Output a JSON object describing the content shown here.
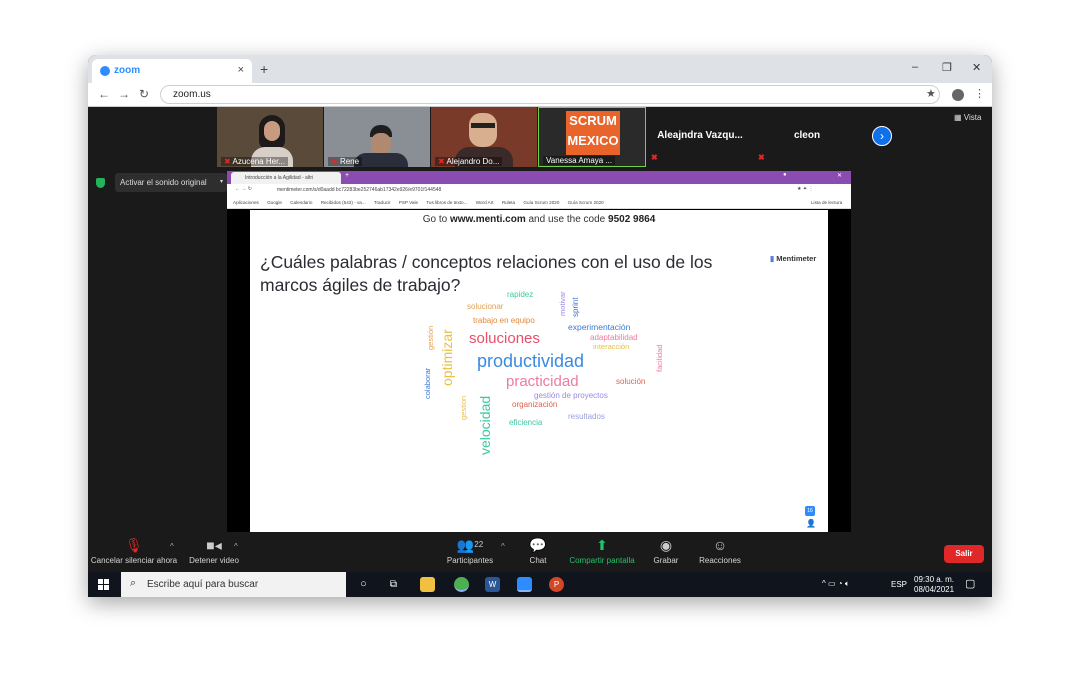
{
  "browser": {
    "tab_title": "zoom",
    "tab_close": "×",
    "new_tab": "+",
    "url": "zoom.us",
    "window_controls": [
      "–",
      "❐",
      "✕"
    ]
  },
  "participants_strip": {
    "videos": [
      {
        "name": "Azucena Her...",
        "bg": "#5a4a3a"
      },
      {
        "name": "Rene",
        "bg": "#8a8f96"
      },
      {
        "name": "Alejandro Do...",
        "bg": "#7a3a2a"
      },
      {
        "name": "Vanessa Amaya ...",
        "bg": "#2a2a2a"
      }
    ],
    "name_only": [
      {
        "name": "Aleajndra Vazqu..."
      },
      {
        "name": "cleon"
      }
    ],
    "scrum_logo_text": [
      "SCRUM",
      "MEXICO"
    ],
    "vista_label": "Vista"
  },
  "audio": {
    "activar_label": "Activar el sonido original"
  },
  "shared_browser": {
    "tab_title": "Introducción a la Agilidad - altri",
    "url": "mentimeter.com/s/d0aadd bc72283be252746ab17342e926/e9701f144548",
    "bookmarks": [
      "Aplicaciones",
      "Google",
      "Calendario",
      "Recibidos (543) - va...",
      "Traducir",
      "PSP Vale",
      "Tus libros de texto...",
      "Word Art",
      "Ruleta",
      "Guía Scrum 2020",
      "Guía Scrum 2020",
      "Lista de lectura"
    ]
  },
  "slide": {
    "goto_prefix": "Go to",
    "goto_site": "www.menti.com",
    "goto_mid": "and use the code",
    "goto_code": "9502 9864",
    "question_line1": "¿Cuáles palabras / conceptos relaciones con el uso de los",
    "question_line2": "marcos ágiles de trabajo?",
    "brand": "Mentimeter",
    "audience_count": "16",
    "words": [
      {
        "text": "rapidez",
        "color": "#3cc8a0"
      },
      {
        "text": "solucionar",
        "color": "#e0a050"
      },
      {
        "text": "trabajo en equipo",
        "color": "#e08a3a"
      },
      {
        "text": "experimentación",
        "color": "#3a7ad0"
      },
      {
        "text": "adaptabilidad",
        "color": "#ef7aa0"
      },
      {
        "text": "interacción",
        "color": "#e8c040"
      },
      {
        "text": "soluciones",
        "color": "#e8506a"
      },
      {
        "text": "productividad",
        "color": "#3a8ae0"
      },
      {
        "text": "practicidad",
        "color": "#ef7aa0"
      },
      {
        "text": "solución",
        "color": "#e06050"
      },
      {
        "text": "gestión de proyectos",
        "color": "#9a8ae0"
      },
      {
        "text": "organización",
        "color": "#e06050"
      },
      {
        "text": "resultados",
        "color": "#9aa0e0"
      },
      {
        "text": "eficiencia",
        "color": "#3cc8a0"
      },
      {
        "text": "optimizar",
        "color": "#e8c040"
      },
      {
        "text": "gestión",
        "color": "#e0a050"
      },
      {
        "text": "colaborar",
        "color": "#3a7ad0"
      },
      {
        "text": "velocidad",
        "color": "#3cc8a0"
      },
      {
        "text": "gestion",
        "color": "#e8c040"
      },
      {
        "text": "motivar",
        "color": "#9a8ae0"
      },
      {
        "text": "sprint",
        "color": "#3a7ad0"
      },
      {
        "text": "facilidad",
        "color": "#ef7aa0"
      }
    ]
  },
  "zoom_toolbar": {
    "mute_label": "Cancelar silenciar ahora",
    "video_label": "Detener video",
    "participants_label": "Participantes",
    "participants_count": "22",
    "chat_label": "Chat",
    "share_label": "Compartir pantalla",
    "record_label": "Grabar",
    "reactions_label": "Reacciones",
    "leave_label": "Salir"
  },
  "taskbar": {
    "search_placeholder": "Escribe aquí para buscar",
    "language": "ESP",
    "time": "09:30 a. m.",
    "date": "08/04/2021"
  }
}
